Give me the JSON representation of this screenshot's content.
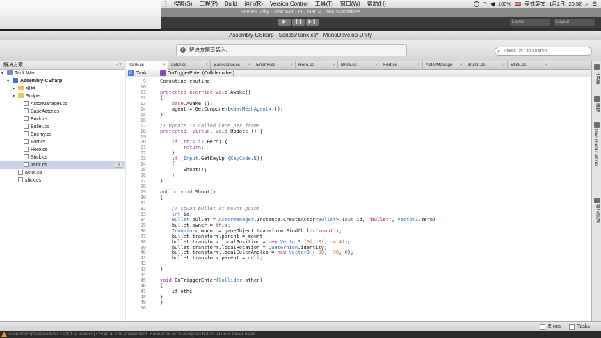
{
  "menubar": {
    "items": [
      ")",
      "搜索(S)",
      "工程(P)",
      "Build",
      "运行(R)",
      "Version Control",
      "工具(T)",
      "窗口(W)",
      "帮助(H)"
    ],
    "battery": "100%",
    "input_method": "美式英文",
    "date": "1月2日",
    "time": "20:52"
  },
  "unity": {
    "title": "Scene1.unity - Tank War - PC, Mac & Linux Standalone",
    "layers_label": "Layers",
    "layout_label": "Layout",
    "console_warning": "Assets/Scripts/BaseActor.cs(9,17): warning CS0414: The private field `BaseActor.cc' is assigned but its value is never used"
  },
  "monodevelop": {
    "title": "Assembly-CSharp - Scripts/Tank.cs* - MonoDevelop-Unity",
    "status_message": "解决方案已装入。",
    "search_placeholder": "Press '⌘.' to search"
  },
  "solution": {
    "header": "解决方案",
    "tree": [
      {
        "label": "Tank War",
        "icon": "solution-icon",
        "indent": 0,
        "expander": "▾"
      },
      {
        "label": "Assembly-CSharp",
        "icon": "project-icon",
        "indent": 1,
        "expander": "▾",
        "bold": true
      },
      {
        "label": "引用",
        "icon": "folder-icon",
        "indent": 2,
        "expander": "▸"
      },
      {
        "label": "Scripts",
        "icon": "folder-icon",
        "indent": 2,
        "expander": "▾"
      },
      {
        "label": "ActorManager.cs",
        "icon": "file-icon",
        "indent": 3,
        "expander": ""
      },
      {
        "label": "BaseActor.cs",
        "icon": "file-icon",
        "indent": 3,
        "expander": ""
      },
      {
        "label": "Brick.cs",
        "icon": "file-icon",
        "indent": 3,
        "expander": ""
      },
      {
        "label": "Bullet.cs",
        "icon": "file-icon",
        "indent": 3,
        "expander": ""
      },
      {
        "label": "Enemy.cs",
        "icon": "file-icon",
        "indent": 3,
        "expander": ""
      },
      {
        "label": "Fort.cs",
        "icon": "file-icon",
        "indent": 3,
        "expander": ""
      },
      {
        "label": "Hero.cs",
        "icon": "file-icon",
        "indent": 3,
        "expander": ""
      },
      {
        "label": "Stick.cs",
        "icon": "file-icon",
        "indent": 3,
        "expander": ""
      },
      {
        "label": "Tank.cs",
        "icon": "file-icon",
        "indent": 3,
        "expander": "",
        "selected": true
      },
      {
        "label": "actor.cs",
        "icon": "file-icon",
        "indent": 2,
        "expander": ""
      },
      {
        "label": "stick.cs",
        "icon": "file-icon",
        "indent": 2,
        "expander": ""
      }
    ]
  },
  "editor": {
    "tabs": [
      "Tank.cs",
      "actor.cs",
      "BaseActor.cs",
      "Enemy.cs",
      "Hero.cs",
      "Brick.cs",
      "Fort.cs",
      "ActorManage",
      "Bullet.cs",
      "Stick.cs"
    ],
    "active_tab": 0,
    "breadcrumb_class": "Tank",
    "breadcrumb_member": "OnTriggerEnter (Collider other)",
    "lines": [
      {
        "n": "9",
        "html": "Coroutine routine;"
      },
      {
        "n": "10",
        "html": ""
      },
      {
        "n": "11",
        "html": "<span class='k'>protected override void</span> Awake()"
      },
      {
        "n": "12",
        "html": "{"
      },
      {
        "n": "13",
        "html": "    <span class='k'>base</span>.Awake ();"
      },
      {
        "n": "14",
        "html": "    agent = GetComponent&lt;<span class='t'>NavMeshAgent</span>&gt; ();"
      },
      {
        "n": "15",
        "html": "}"
      },
      {
        "n": "16",
        "html": ""
      },
      {
        "n": "17",
        "html": "<span class='cm'>// Update is called once per frame</span>"
      },
      {
        "n": "18",
        "html": "<span class='k'>protected  virtual void</span> Update () {"
      },
      {
        "n": "19",
        "html": ""
      },
      {
        "n": "20",
        "html": "    <span class='k'>if</span> (<span class='k'>this is</span> Hero) {"
      },
      {
        "n": "21",
        "html": "        <span class='k'>return</span>;"
      },
      {
        "n": "22",
        "html": "    }"
      },
      {
        "n": "23",
        "html": "    <span class='k'>if</span> (<span class='t'>Input</span>.GetKeyUp (<span class='t'>KeyCode</span>.S))"
      },
      {
        "n": "24",
        "html": "    {"
      },
      {
        "n": "25",
        "html": "        Shoot();"
      },
      {
        "n": "26",
        "html": "    }"
      },
      {
        "n": "27",
        "html": "}"
      },
      {
        "n": "28",
        "html": ""
      },
      {
        "n": "29",
        "html": "<span class='k'>public void</span> Shoot()"
      },
      {
        "n": "30",
        "html": "{"
      },
      {
        "n": "31",
        "html": ""
      },
      {
        "n": "32",
        "html": "    <span class='cm'>// spwan bullet at mount point</span>"
      },
      {
        "n": "33",
        "html": "    <span class='k'>int</span> id;"
      },
      {
        "n": "34",
        "html": "    <span class='t'>Bullet</span> bullet = <span class='t'>ActorManager</span>.Instance.CreateActor&lt;<span class='t'>Bullet</span>&gt; (<span class='k'>out</span> id, <span class='s'>\"bullet\"</span>, <span class='t'>Vector3</span>.zero) ;"
      },
      {
        "n": "35",
        "html": "    bullet.owner = <span class='k'>this</span>;"
      },
      {
        "n": "36",
        "html": "    <span class='t'>Transform</span> mount = gameObject.transform.FindChild(<span class='s'>\"mount\"</span>);"
      },
      {
        "n": "37",
        "html": "    bullet.transform.parent = mount;"
      },
      {
        "n": "38",
        "html": "    bullet.transform.localPosition = <span class='k'>new</span> <span class='t'>Vector3</span> (<span class='n'>0f</span>, <span class='n'>0f</span>, <span class='n'>-4.4f</span>);"
      },
      {
        "n": "39",
        "html": "    bullet.transform.localRotation = <span class='t'>Quaternion</span>.identity;"
      },
      {
        "n": "40",
        "html": "    bullet.transform.localEulerAngles = <span class='k'>new</span> <span class='t'>Vector3</span> (<span class='n'>-90</span>, <span class='n'>-90</span>, <span class='n'>0</span>);"
      },
      {
        "n": "41",
        "html": "    bullet.transform.parent = <span class='k'>null</span>;"
      },
      {
        "n": "42",
        "html": ""
      },
      {
        "n": "43",
        "html": "}"
      },
      {
        "n": "44",
        "html": ""
      },
      {
        "n": "45",
        "html": "<span class='k'>void</span> OnTriggerEnter(<span class='t'>Collider</span> other)"
      },
      {
        "n": "46",
        "html": "{"
      },
      {
        "n": "47",
        "html": "    if(othe"
      },
      {
        "n": "48",
        "html": "}"
      },
      {
        "n": "49",
        "html": "}"
      },
      {
        "n": "50",
        "html": ""
      }
    ]
  },
  "right_dock": {
    "items": [
      "工具箱",
      "属性",
      "Document Outline",
      "单元测试"
    ]
  },
  "bottom_pads": {
    "errors_label": "Errors",
    "tasks_label": "Tasks"
  }
}
